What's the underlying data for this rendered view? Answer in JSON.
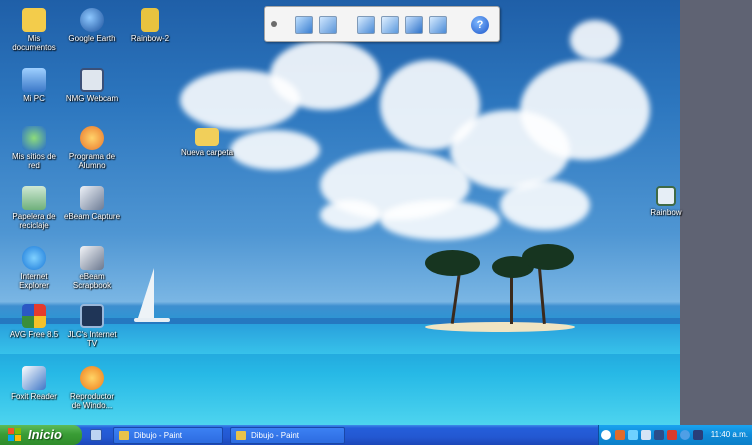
{
  "desktop_icons": [
    {
      "label": "Mis\ndocumentos",
      "icon": "folder-documents-icon"
    },
    {
      "label": "Google Earth",
      "icon": "google-earth-icon"
    },
    {
      "label": "Rainbow-2",
      "icon": "rainbow-book-icon"
    },
    {
      "label": "Mi PC",
      "icon": "computer-icon"
    },
    {
      "label": "NMG Webcam",
      "icon": "webcam-icon"
    },
    {
      "label": "Mis sitios de\nred",
      "icon": "network-places-icon"
    },
    {
      "label": "Programa de\nAlumno",
      "icon": "student-program-icon"
    },
    {
      "label": "Nueva carpeta",
      "icon": "folder-icon"
    },
    {
      "label": "Papelera de\nreciclaje",
      "icon": "recycle-bin-icon"
    },
    {
      "label": "eBeam Capture",
      "icon": "ebeam-capture-icon"
    },
    {
      "label": "Rainbow",
      "icon": "rainbow-app-icon"
    },
    {
      "label": "Internet\nExplorer",
      "icon": "internet-explorer-icon"
    },
    {
      "label": "eBeam\nScrapbook",
      "icon": "ebeam-scrapbook-icon"
    },
    {
      "label": "AVG Free 8.5",
      "icon": "avg-antivirus-icon"
    },
    {
      "label": "JLC's Internet\nTV",
      "icon": "internet-tv-icon"
    },
    {
      "label": "Foxit Reader",
      "icon": "foxit-reader-icon"
    },
    {
      "label": "Reproductor\nde Windo...",
      "icon": "media-player-icon"
    }
  ],
  "taskbar": {
    "start_label": "Inicio",
    "tasks": [
      "Dibujo - Paint",
      "Dibujo - Paint"
    ],
    "clock": "11:40 a.m."
  },
  "colors": {
    "taskbar_blue": "#245edb",
    "start_green": "#3a9d36",
    "tray_blue": "#0e8ad8"
  }
}
